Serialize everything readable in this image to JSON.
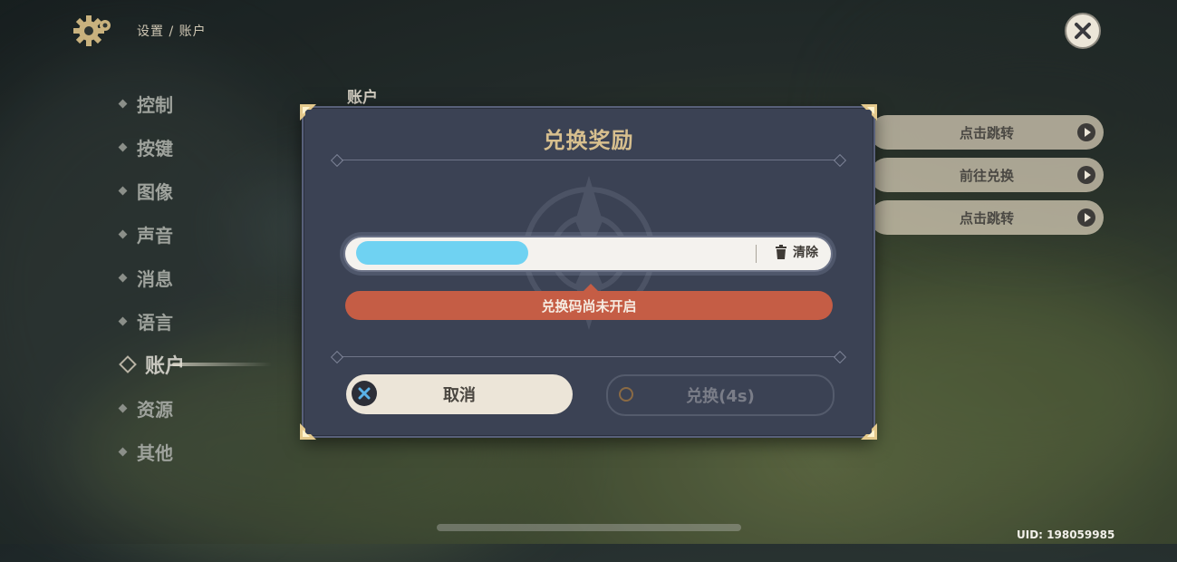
{
  "header": {
    "breadcrumb": "设置 / 账户",
    "settings_icon": "gear-icon",
    "close_icon": "close-icon"
  },
  "sidebar": {
    "items": [
      {
        "label": "控制"
      },
      {
        "label": "按键"
      },
      {
        "label": "图像"
      },
      {
        "label": "声音"
      },
      {
        "label": "消息"
      },
      {
        "label": "语言"
      },
      {
        "label": "账户",
        "active": true
      },
      {
        "label": "资源"
      },
      {
        "label": "其他"
      }
    ]
  },
  "main": {
    "section_title": "账户",
    "links": [
      {
        "label": "点击跳转"
      },
      {
        "label": "前往兑换"
      },
      {
        "label": "点击跳转"
      }
    ]
  },
  "dialog": {
    "title": "兑换奖励",
    "input_value": "",
    "clear_label": "清除",
    "error_message": "兑换码尚未开启",
    "cancel_label": "取消",
    "redeem_label": "兑换(4s)"
  },
  "footer": {
    "uid": "UID: 198059985"
  },
  "colors": {
    "dialog_bg": "#3b4254",
    "title_gold": "#d7bf8e",
    "error_red": "#c55d45",
    "button_cream": "#ece5d8",
    "redacted_blue": "#6fd2f2"
  }
}
